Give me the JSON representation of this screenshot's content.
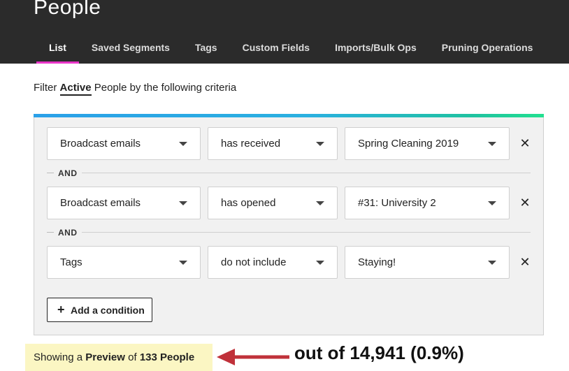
{
  "header": {
    "title": "People",
    "tabs": [
      {
        "label": "List",
        "active": true
      },
      {
        "label": "Saved Segments",
        "active": false
      },
      {
        "label": "Tags",
        "active": false
      },
      {
        "label": "Custom Fields",
        "active": false
      },
      {
        "label": "Imports/Bulk Ops",
        "active": false
      },
      {
        "label": "Pruning Operations",
        "active": false
      }
    ]
  },
  "filter": {
    "prefix": "Filter",
    "status": "Active",
    "suffix": "People by the following criteria",
    "conditions": [
      {
        "field": "Broadcast emails",
        "operator": "has received",
        "value": "Spring Cleaning 2019"
      },
      {
        "field": "Broadcast emails",
        "operator": "has opened",
        "value": "#31: University 2"
      },
      {
        "field": "Tags",
        "operator": "do not include",
        "value": "Staying!"
      }
    ],
    "joiner": "AND",
    "add_condition_label": "Add a condition"
  },
  "preview": {
    "prefix": "Showing a",
    "preview_word": "Preview",
    "of_word": "of",
    "count_label": "133 People"
  },
  "annotation": {
    "text": "out of 14,941 (0.9%)",
    "arrow_color": "#c0313a"
  },
  "colors": {
    "header_bg": "#2b2b2b",
    "active_tab_underline": "#e835c8",
    "preview_bg": "#fbf6c3"
  },
  "icons": {
    "remove": "close-icon",
    "dropdown": "chevron-down-icon",
    "add": "plus-icon"
  }
}
